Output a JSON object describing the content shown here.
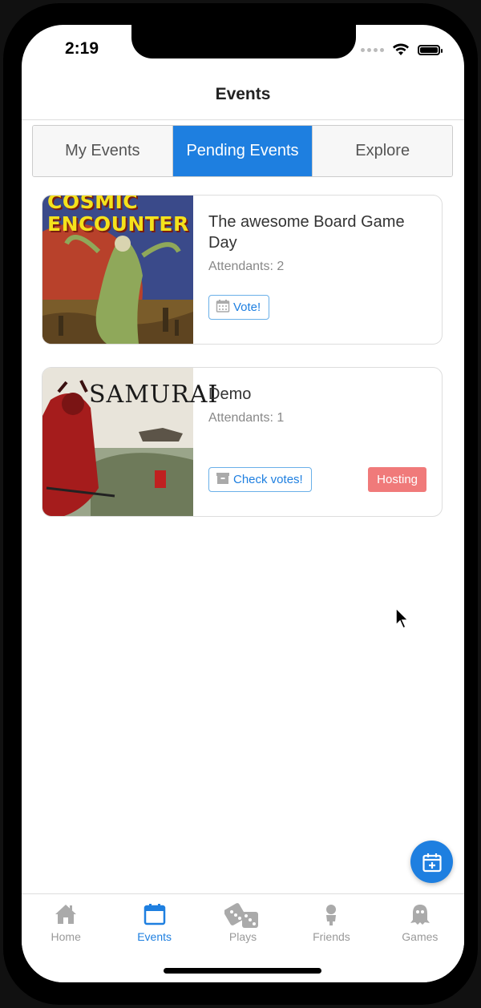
{
  "status": {
    "time": "2:19"
  },
  "nav": {
    "title": "Events"
  },
  "tabs": [
    {
      "label": "My Events",
      "active": false
    },
    {
      "label": "Pending Events",
      "active": true
    },
    {
      "label": "Explore",
      "active": false
    }
  ],
  "events": [
    {
      "cover_text": "COSMIC ENCOUNTER",
      "title": "The awesome Board Game Day",
      "attendants": "Attendants: 2",
      "action_label": "Vote!",
      "action_icon": "calendar-icon"
    },
    {
      "cover_text": "SAMURAI",
      "title": "Demo",
      "attendants": "Attendants: 1",
      "action_label": "Check votes!",
      "action_icon": "archive-icon",
      "badge": "Hosting"
    }
  ],
  "fab": {
    "icon": "calendar-plus-icon"
  },
  "tabbar": [
    {
      "label": "Home",
      "icon": "home-icon"
    },
    {
      "label": "Events",
      "icon": "calendar-icon",
      "active": true
    },
    {
      "label": "Plays",
      "icon": "dice-icon"
    },
    {
      "label": "Friends",
      "icon": "person-icon"
    },
    {
      "label": "Games",
      "icon": "ghost-icon"
    }
  ],
  "colors": {
    "accent": "#1e7fe0",
    "hosting": "#f07a7a"
  }
}
